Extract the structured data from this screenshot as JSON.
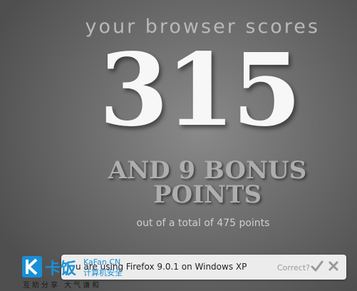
{
  "colors": {
    "background": "#6f6f6f",
    "score": "#f7f7f7",
    "bonus": "#aeaeae",
    "bar": "#ececec",
    "watermark_blue": "#1a8fd6"
  },
  "results": {
    "heading": "your browser scores",
    "score": "315",
    "bonus_line1": "AND 9 BONUS",
    "bonus_line2": "POINTS",
    "total": "out of a total of 475 points"
  },
  "detection_bar": {
    "browser_text": "u are using Firefox 9.0.1 on Windows XP",
    "question": "Correct?",
    "yes_icon": "checkmark-icon",
    "no_icon": "cross-icon"
  },
  "watermark": {
    "logo_text": "卡饭",
    "name": "KaFan.CN",
    "subtitle": "计算机安全",
    "bottom": "互助分享  大气谦和"
  }
}
